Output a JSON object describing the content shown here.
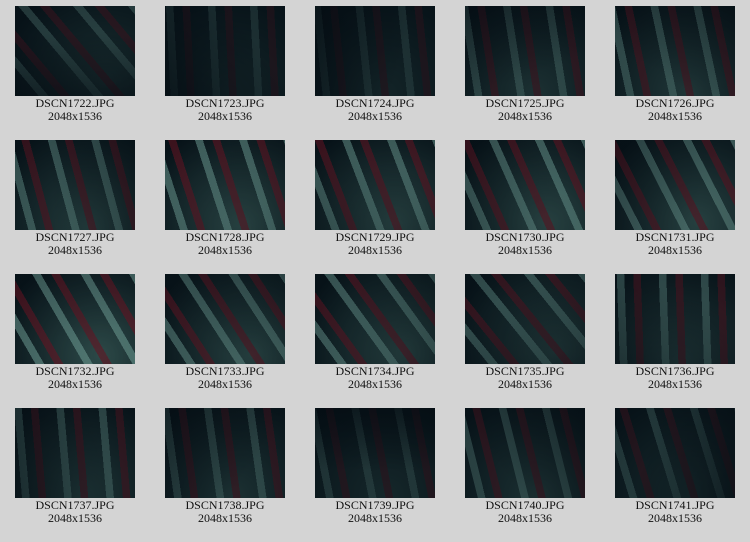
{
  "thumbnails": [
    {
      "name": "DSCN1722.JPG",
      "size": "2048x1536",
      "brightness": 0.45
    },
    {
      "name": "DSCN1723.JPG",
      "size": "2048x1536",
      "brightness": 0.3
    },
    {
      "name": "DSCN1724.JPG",
      "size": "2048x1536",
      "brightness": 0.3
    },
    {
      "name": "DSCN1725.JPG",
      "size": "2048x1536",
      "brightness": 0.5
    },
    {
      "name": "DSCN1726.JPG",
      "size": "2048x1536",
      "brightness": 0.6
    },
    {
      "name": "DSCN1727.JPG",
      "size": "2048x1536",
      "brightness": 0.7
    },
    {
      "name": "DSCN1728.JPG",
      "size": "2048x1536",
      "brightness": 0.85
    },
    {
      "name": "DSCN1729.JPG",
      "size": "2048x1536",
      "brightness": 0.8
    },
    {
      "name": "DSCN1730.JPG",
      "size": "2048x1536",
      "brightness": 0.8
    },
    {
      "name": "DSCN1731.JPG",
      "size": "2048x1536",
      "brightness": 0.75
    },
    {
      "name": "DSCN1732.JPG",
      "size": "2048x1536",
      "brightness": 0.9
    },
    {
      "name": "DSCN1733.JPG",
      "size": "2048x1536",
      "brightness": 0.75
    },
    {
      "name": "DSCN1734.JPG",
      "size": "2048x1536",
      "brightness": 0.75
    },
    {
      "name": "DSCN1735.JPG",
      "size": "2048x1536",
      "brightness": 0.65
    },
    {
      "name": "DSCN1736.JPG",
      "size": "2048x1536",
      "brightness": 0.6
    },
    {
      "name": "DSCN1737.JPG",
      "size": "2048x1536",
      "brightness": 0.55
    },
    {
      "name": "DSCN1738.JPG",
      "size": "2048x1536",
      "brightness": 0.5
    },
    {
      "name": "DSCN1739.JPG",
      "size": "2048x1536",
      "brightness": 0.35
    },
    {
      "name": "DSCN1740.JPG",
      "size": "2048x1536",
      "brightness": 0.5
    },
    {
      "name": "DSCN1741.JPG",
      "size": "2048x1536",
      "brightness": 0.4
    }
  ]
}
